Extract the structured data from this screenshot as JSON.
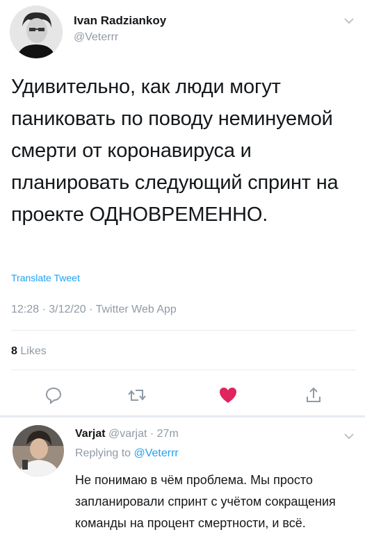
{
  "tweet": {
    "author_name": "Ivan Radziankoу",
    "author_handle": "@Veterrr",
    "text": "Удивительно, как люди могут паниковать по поводу неминуемой смерти от коронавируса и планировать следующий спринт на проекте ОДНОВРЕМЕННО.",
    "translate_label": "Translate Tweet",
    "time": "12:28",
    "date": "3/12/20",
    "separator": "·",
    "source": "Twitter Web App",
    "likes_count": "8",
    "likes_label": "Likes"
  },
  "actions": {
    "reply": "comment-icon",
    "retweet": "retweet-icon",
    "like": "heart-icon",
    "share": "share-icon",
    "like_color": "#e0245e"
  },
  "reply": {
    "author_name": "Varjat",
    "author_handle": "@varjat",
    "separator": "·",
    "age": "27m",
    "replying_prefix": "Replying to",
    "replying_to": "@Veterrr",
    "text": "Не понимаю в чём проблема. Мы просто запланировали спринт с учётом сокращения команды на процент смертности, и всё."
  },
  "colors": {
    "link": "#1da1f2",
    "muted": "#8f9aa5",
    "divider": "#e6ecf0"
  }
}
